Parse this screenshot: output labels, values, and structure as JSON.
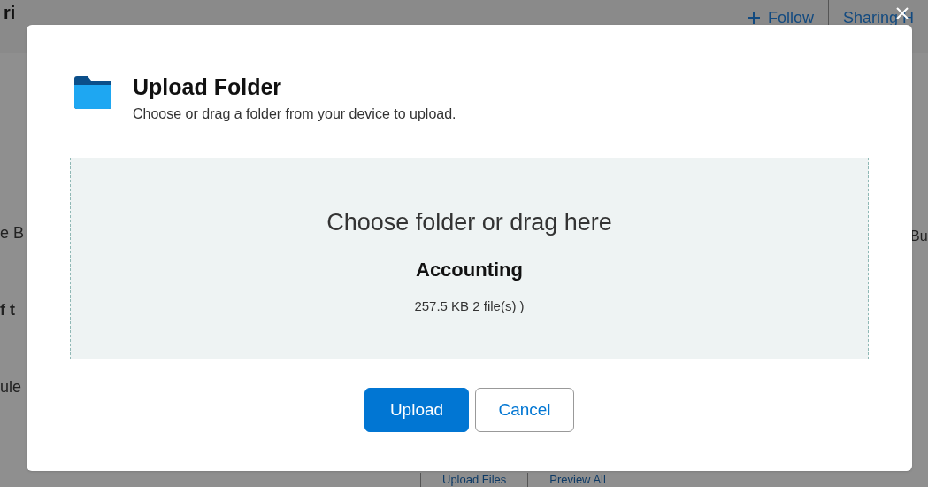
{
  "background": {
    "title": "ri",
    "actions": [
      "Follow",
      "Sharing H"
    ],
    "left_snippets": [
      "e B",
      "f t",
      "ule"
    ],
    "right_snippets": [
      "Bu"
    ],
    "bottom_buttons": [
      "Upload Files",
      "Preview All"
    ]
  },
  "dialog": {
    "title": "Upload Folder",
    "subtitle": "Choose or drag a folder from your device to upload.",
    "dropzone": {
      "prompt": "Choose folder or drag here",
      "folder_name": "Accounting",
      "summary": "257.5 KB 2 file(s) )"
    },
    "buttons": [
      {
        "label": "Upload",
        "kind": "primary"
      },
      {
        "label": "Cancel",
        "kind": "neutral"
      }
    ]
  }
}
